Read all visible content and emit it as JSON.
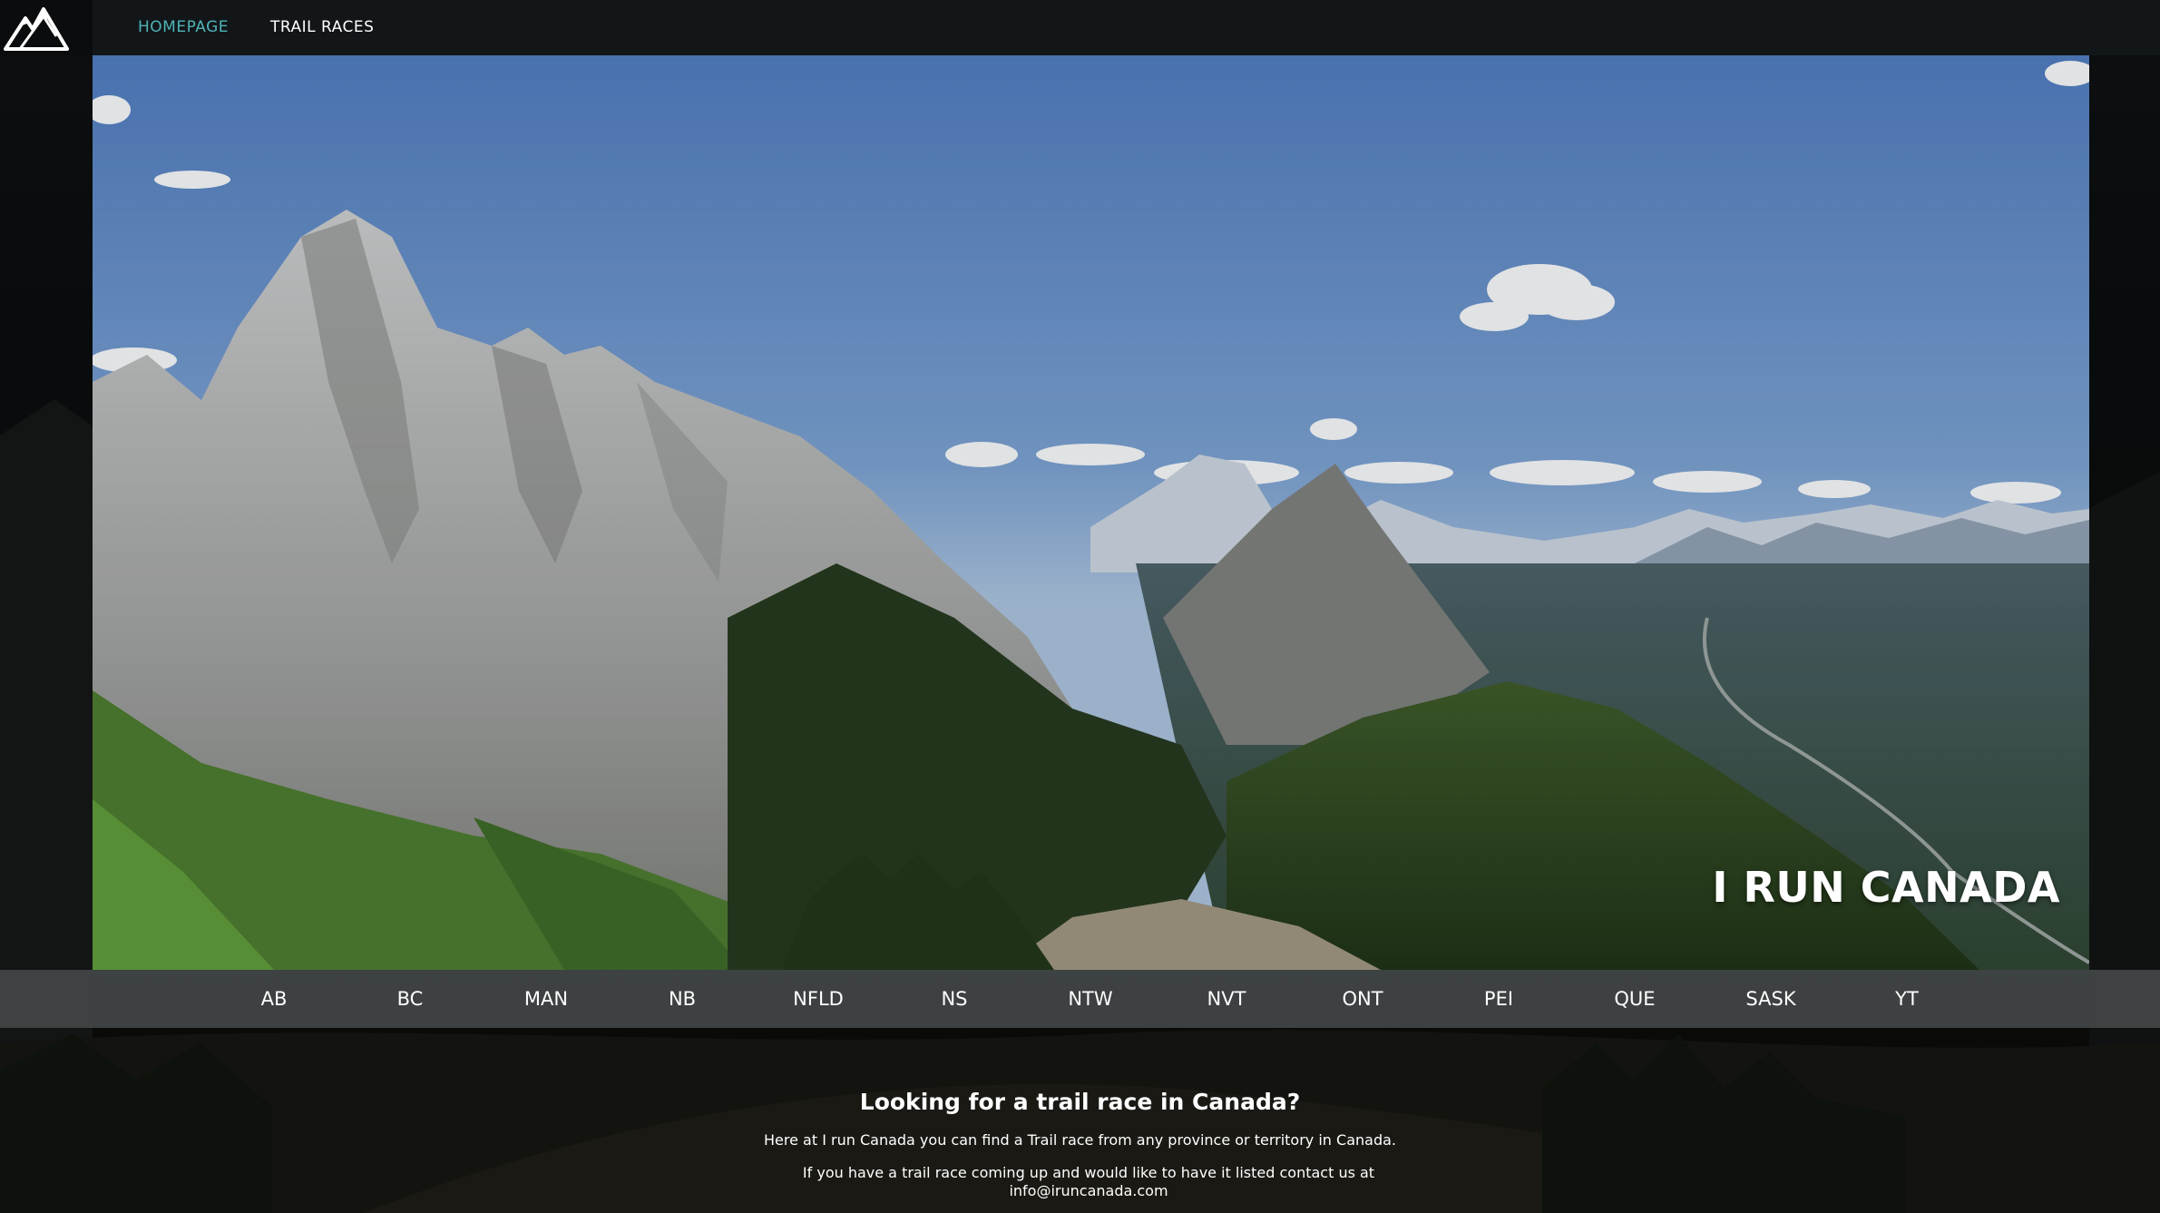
{
  "nav": {
    "logo_icon": "mountain-logo-icon",
    "links": [
      {
        "label": "HOMEPAGE",
        "active": true,
        "color": "#4fb3b7"
      },
      {
        "label": "TRAIL RACES",
        "active": false,
        "color": "#ffffff"
      }
    ]
  },
  "hero": {
    "title": "I RUN CANADA"
  },
  "provinces": [
    "AB",
    "BC",
    "MAN",
    "NB",
    "NFLD",
    "NS",
    "NTW",
    "NVT",
    "ONT",
    "PEI",
    "QUE",
    "SASK",
    "YT"
  ],
  "intro": {
    "heading": "Looking for a trail race in Canada?",
    "line1": "Here at I run Canada you can find a Trail race from any province or territory in Canada.",
    "line2": "If you have a trail race coming up and would like to have it listed contact us at info@iruncanada.com"
  },
  "colors": {
    "accent": "#4fb3b7",
    "topbar": "#14171a",
    "province_bar": "#424648"
  }
}
